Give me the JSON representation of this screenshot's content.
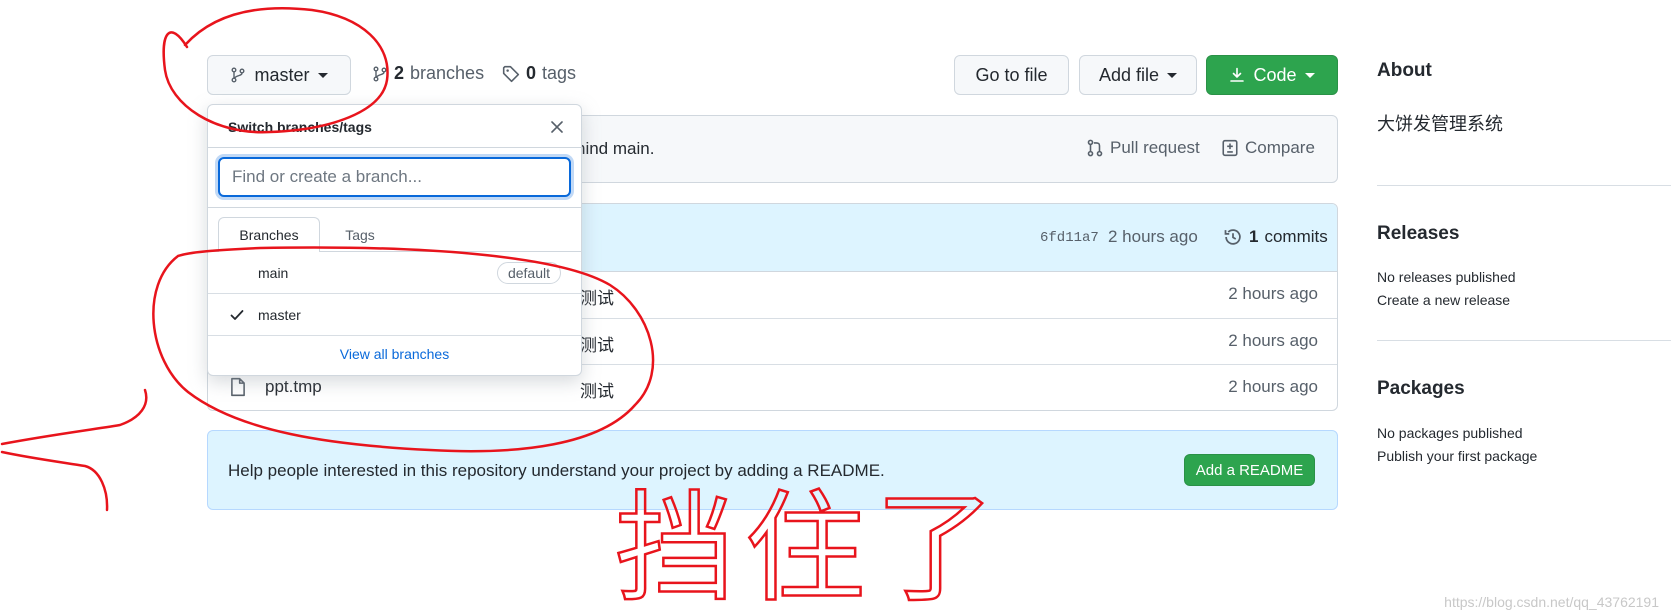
{
  "toolbar": {
    "branch_button": "master",
    "branches_count": "2",
    "branches_label": "branches",
    "tags_count": "0",
    "tags_label": "tags",
    "go_to_file": "Go to file",
    "add_file": "Add file",
    "code": "Code"
  },
  "compare_bar": {
    "message_tail": "hind main.",
    "pull_request": "Pull request",
    "compare": "Compare"
  },
  "commit": {
    "sha": "6fd11a7",
    "time": "2 hours ago",
    "count": "1",
    "label": "commits"
  },
  "files": [
    {
      "name": "",
      "message": "测试",
      "time": "2 hours ago"
    },
    {
      "name": "",
      "message": "测试",
      "time": "2 hours ago"
    },
    {
      "name": "ppt.tmp",
      "message": "测试",
      "time": "2 hours ago"
    }
  ],
  "readme": {
    "text": "Help people interested in this repository understand your project by adding a README.",
    "button": "Add a README"
  },
  "dropdown": {
    "title": "Switch branches/tags",
    "input_placeholder": "Find or create a branch...",
    "tabs": [
      "Branches",
      "Tags"
    ],
    "items": [
      {
        "name": "main",
        "badge": "default",
        "selected": false
      },
      {
        "name": "master",
        "badge": "",
        "selected": true
      }
    ],
    "view_all": "View all branches"
  },
  "sidebar": {
    "about_title": "About",
    "description": "大饼发管理系统",
    "releases_title": "Releases",
    "releases_text": "No releases published",
    "releases_link": "Create a new release",
    "packages_title": "Packages",
    "packages_text": "No packages published",
    "packages_link": "Publish your first package"
  },
  "annotation_text": "挡住了",
  "watermark": "https://blog.csdn.net/qq_43762191",
  "colors": {
    "primary_green": "#2da44e",
    "link_blue": "#0969da",
    "border": "#d0d7de",
    "annotation_red": "#e8141c"
  }
}
